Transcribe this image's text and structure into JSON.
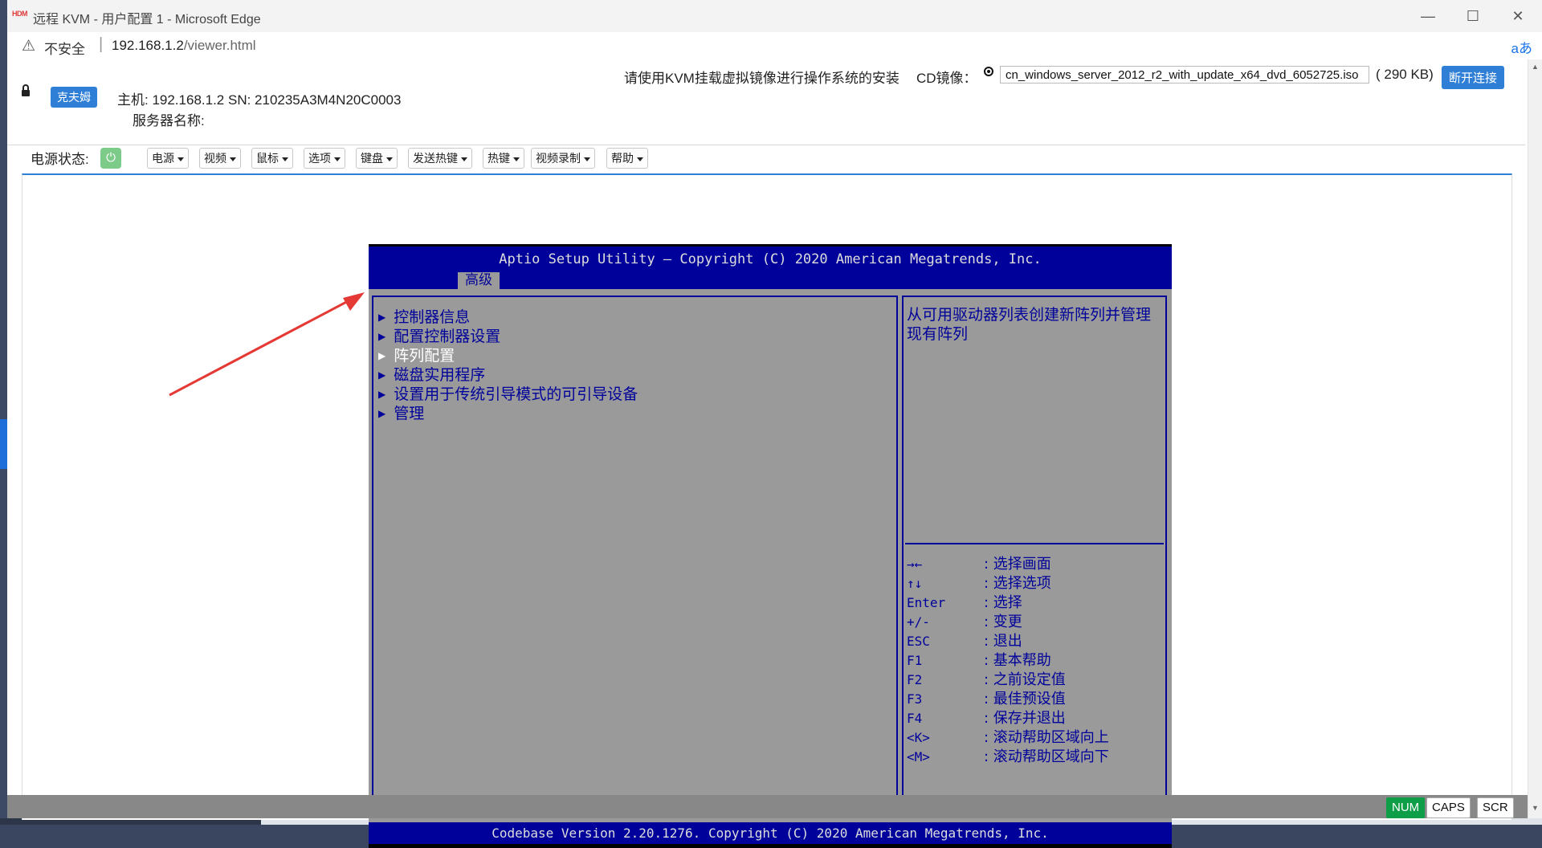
{
  "browser": {
    "window_title": "远程 KVM - 用户配置 1 - Microsoft Edge",
    "app_logo_text": "HDM",
    "security_label": "不安全",
    "url_host": "192.168.1.2",
    "url_path": "/viewer.html",
    "read_aloud_icon": "aあ",
    "minimize": "—",
    "maximize": "☐",
    "close": "✕"
  },
  "kvm": {
    "user_button": "克夫姆",
    "host_info": "主机:  192.168.1.2 SN:  210235A3M4N20C0003",
    "server_name": "服务器名称:",
    "cd_note": "请使用KVM挂载虚拟镜像进行操作系统的安装",
    "cd_label": "CD镜像：",
    "cd_file": "cn_windows_server_2012_r2_with_update_x64_dvd_6052725.iso",
    "cd_size": "( 290 KB)",
    "disconnect_button": "断开连接",
    "power_label": "电源状态:",
    "power_icon": "⏻",
    "menus": [
      "电源",
      "视频",
      "鼠标",
      "选项",
      "键盘",
      "发送热键",
      "热键",
      "视频录制",
      "帮助"
    ]
  },
  "bios": {
    "title": "Aptio Setup Utility – Copyright (C) 2020 American Megatrends, Inc.",
    "tab": "高级",
    "menu_items": [
      "控制器信息",
      "配置控制器设置",
      "阵列配置",
      "磁盘实用程序",
      "设置用于传统引导模式的可引导设备",
      "管理"
    ],
    "selected_item": "阵列配置",
    "help_text": "从可用驱动器列表创建新阵列并管理现有阵列",
    "keys": [
      {
        "key": "→←",
        "desc": ": 选择画面"
      },
      {
        "key": "↑↓",
        "desc": ": 选择选项"
      },
      {
        "key": "Enter",
        "desc": ": 选择"
      },
      {
        "key": "+/-",
        "desc": ": 变更"
      },
      {
        "key": "ESC",
        "desc": ": 退出"
      },
      {
        "key": "F1",
        "desc": ": 基本帮助"
      },
      {
        "key": "F2",
        "desc": ": 之前设定值"
      },
      {
        "key": "F3",
        "desc": ": 最佳预设值"
      },
      {
        "key": "F4",
        "desc": ": 保存并退出"
      },
      {
        "key": "<K>",
        "desc": ": 滚动帮助区域向上"
      },
      {
        "key": "<M>",
        "desc": ": 滚动帮助区域向下"
      }
    ],
    "footer": "Codebase Version 2.20.1276. Copyright (C) 2020 American Megatrends, Inc."
  },
  "status_indicators": [
    {
      "label": "NUM",
      "active": true
    },
    {
      "label": "CAPS",
      "active": false
    },
    {
      "label": "SCR",
      "active": false
    }
  ],
  "colors": {
    "bios_blue": "#00009a",
    "bios_gray": "#9a9a9a",
    "accent": "#2f7fd6",
    "annotation_arrow": "#e53935"
  }
}
